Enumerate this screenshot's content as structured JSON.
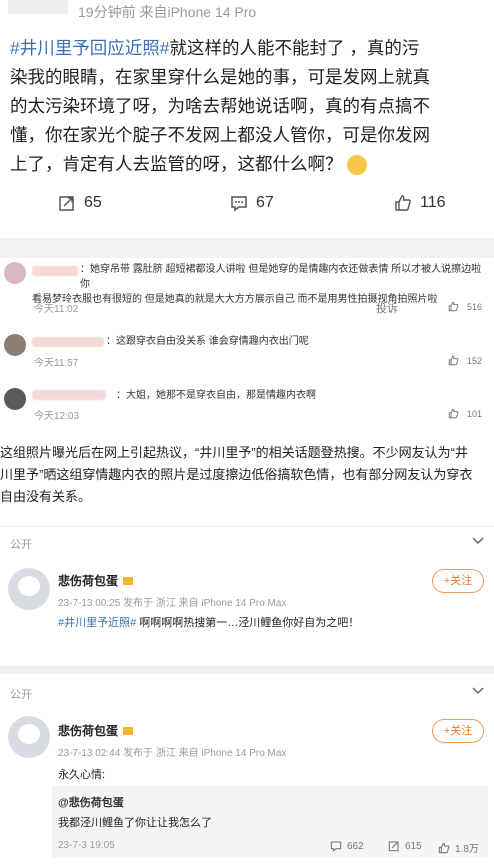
{
  "post": {
    "meta": "19分钟前  来自iPhone 14 Pro",
    "hashtag": "#井川里予回应近照#",
    "body_line1_rest": "就这样的人能不能封了 ，真的污",
    "body_lines": [
      "染我的眼睛，在家里穿什么是她的事，可是发网上就真",
      "的太污染环境了呀，为啥去帮她说话啊，真的有点搞不",
      "懂，你在家光个腚子不发网上都没人管你，可是你发网",
      "上了，肯定有人去监管的呀，这都什么啊？"
    ],
    "reposts": "65",
    "comments": "67",
    "likes": "116"
  },
  "comments": [
    {
      "text_line1": "：她穿吊带 露肚脐 超短裙都没人讲啦 但是她穿的是情趣内衣还做表情 所以才被人说擦边啦 你",
      "text_line2": "看易梦玲衣服也有很短的 但是她真的就是大大方方展示自己 而不是用男性拍摄视角拍照片啦",
      "time": "今天11:02",
      "report": "投诉",
      "likes": "516"
    },
    {
      "text_line1": "：这跟穿衣自由没关系 谁会穿情趣内衣出门呢",
      "time": "今天11:57",
      "likes": "152"
    },
    {
      "text_line1": "：大姐，她那不是穿衣自由，那是情趣内衣啊",
      "time": "今天12:03",
      "likes": "101"
    }
  ],
  "article": {
    "line1": "这组照片曝光后在网上引起热议，“井川里予”的相关话题登热搜。不少网友认为“井",
    "line2": "川里予”晒这组穿情趣内衣的照片是过度擦边低俗搞软色情，也有部分网友认为穿衣",
    "line3": "自由没有关系。"
  },
  "weibo1": {
    "public_label": "公开",
    "username": "悲伤荷包蛋",
    "follow": "+关注",
    "meta": "23-7-13 00:25 发布于 浙江  来自 iPhone 14 Pro Max",
    "hashtag": "#井川里予近照#",
    "text": " 啊啊啊啊热搜第一…泾川鲤鱼你好自为之吧！"
  },
  "weibo2": {
    "public_label": "公开",
    "username": "悲伤荷包蛋",
    "follow": "+关注",
    "meta": "23-7-13 02:44 发布于 浙江  来自 iPhone 14 Pro Max",
    "text": "永久心情:",
    "quote_user": "@悲伤荷包蛋",
    "quote_text": "我都泾川鲤鱼了你让让我怎么了",
    "quote_time": "23-7-3 19:05",
    "quote_comments": "662",
    "quote_reposts": "615",
    "quote_likes": "1.8万"
  },
  "colors": {
    "link": "#3a6fb5",
    "accent": "#f07a2a"
  }
}
